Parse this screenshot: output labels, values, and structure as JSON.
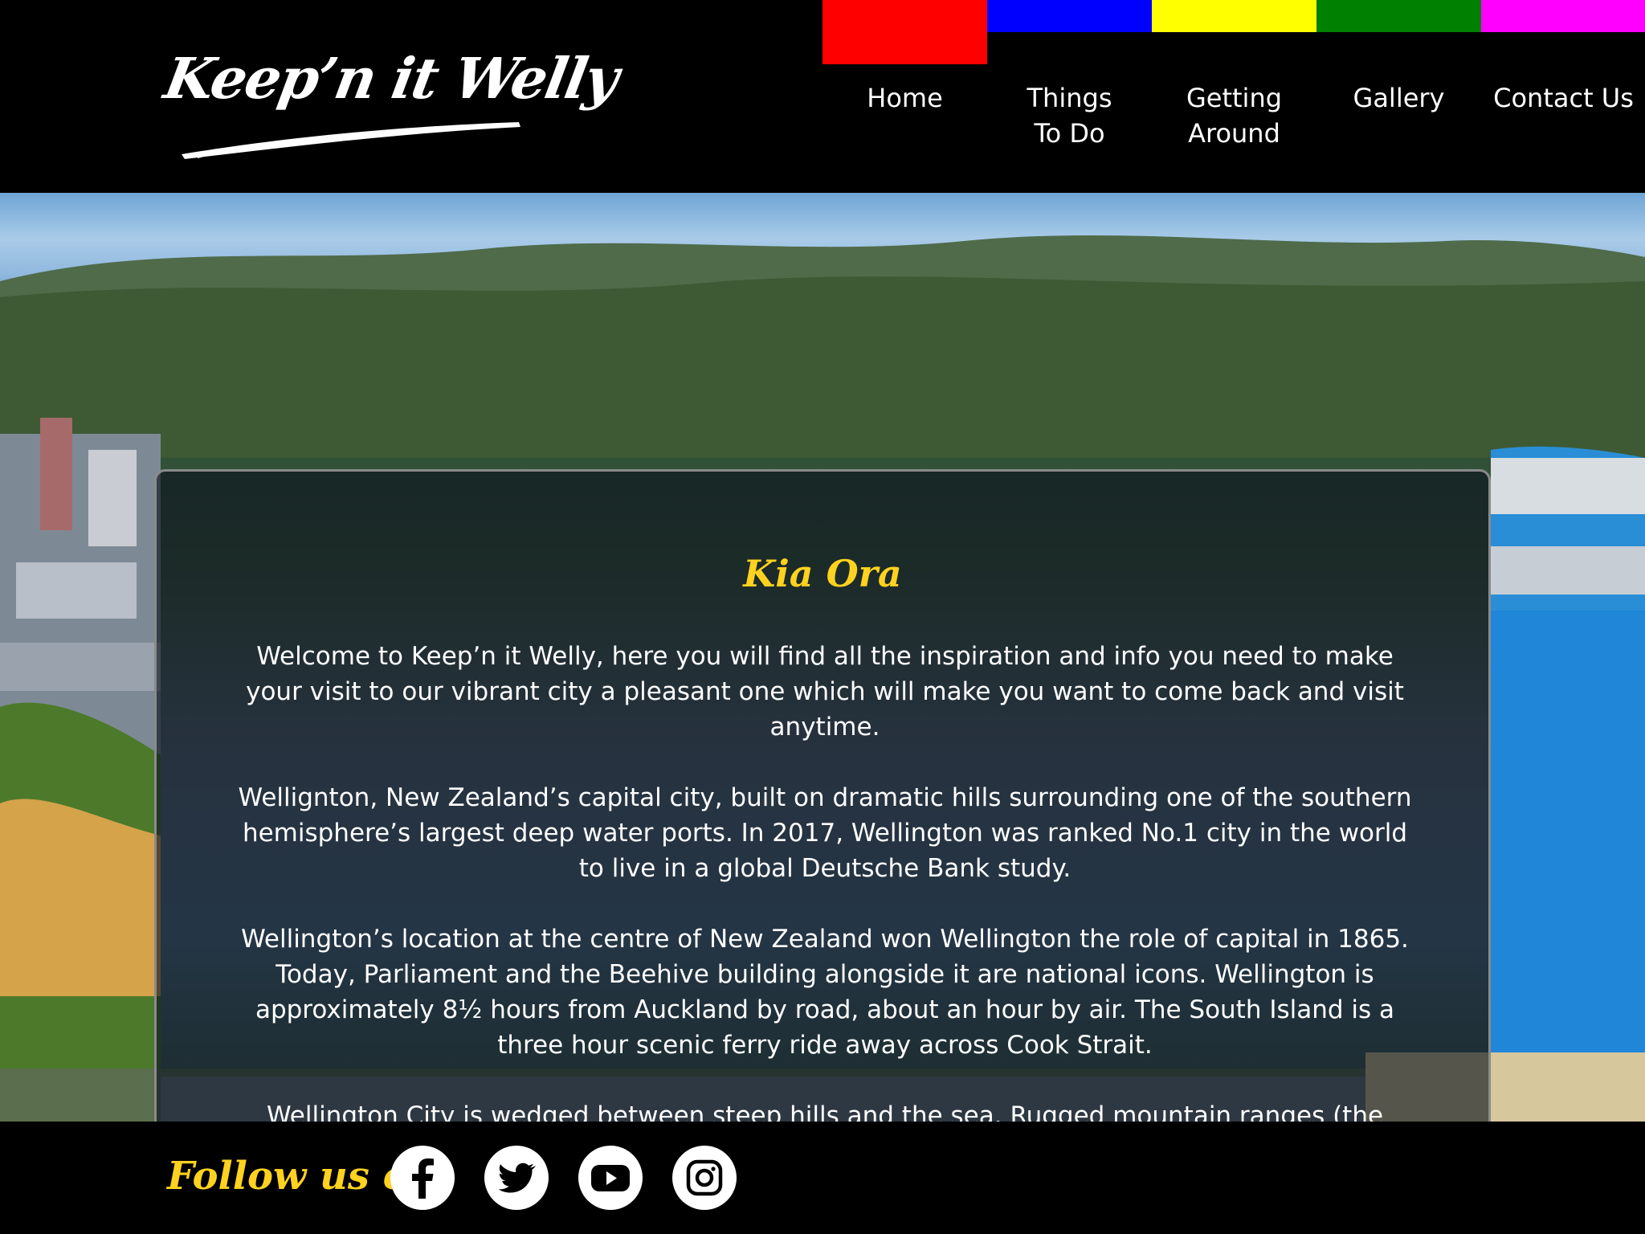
{
  "header": {
    "logo_text": "Keep’n it Welly",
    "nav": [
      {
        "label_line1": "Home",
        "label_line2": "",
        "color": "#ff0000",
        "active": true
      },
      {
        "label_line1": "Things",
        "label_line2": "To Do",
        "color": "#0000ff",
        "active": false
      },
      {
        "label_line1": "Getting",
        "label_line2": "Around",
        "color": "#ffff00",
        "active": false
      },
      {
        "label_line1": "Gallery",
        "label_line2": "",
        "color": "#008000",
        "active": false
      },
      {
        "label_line1": "Contact Us",
        "label_line2": "",
        "color": "#ff00ff",
        "active": false
      }
    ]
  },
  "main": {
    "title": "Kia Ora",
    "paragraphs": [
      "Welcome to Keep’n it Welly, here you will find all the inspiration and info you need to make your visit to our vibrant city a pleasant one which will make you want to come back and visit anytime.",
      "Wellignton, New Zealand’s capital city, built on dramatic hills surrounding one of the southern hemisphere’s largest deep water ports. In 2017, Wellington was ranked No.1 city in the world to live in a global Deutsche Bank study.",
      "Wellington’s location at the centre of New Zealand won Wellington the role of capital in 1865. Today, Parliament and the Beehive building alongside it are national icons. Wellington is approximately 8½ hours from Auckland by road, about an hour by air. The South Island is a three hour scenic ferry ride away across Cook Strait.",
      "Wellington City is wedged between steep hills and the sea. Rugged mountain ranges (the Rimutakas and the Tararuas) loom beyond the harbour. The diversity of natural resources means within 10-15 minutes, you can be walking or mountain biking in native bush, or kayaking around the coastline."
    ]
  },
  "footer": {
    "follow_label": "Follow us on:",
    "social_icons": [
      "facebook-icon",
      "twitter-icon",
      "youtube-icon",
      "instagram-icon"
    ]
  },
  "colors": {
    "accent_yellow": "#ffd21f",
    "background": "#000000"
  }
}
